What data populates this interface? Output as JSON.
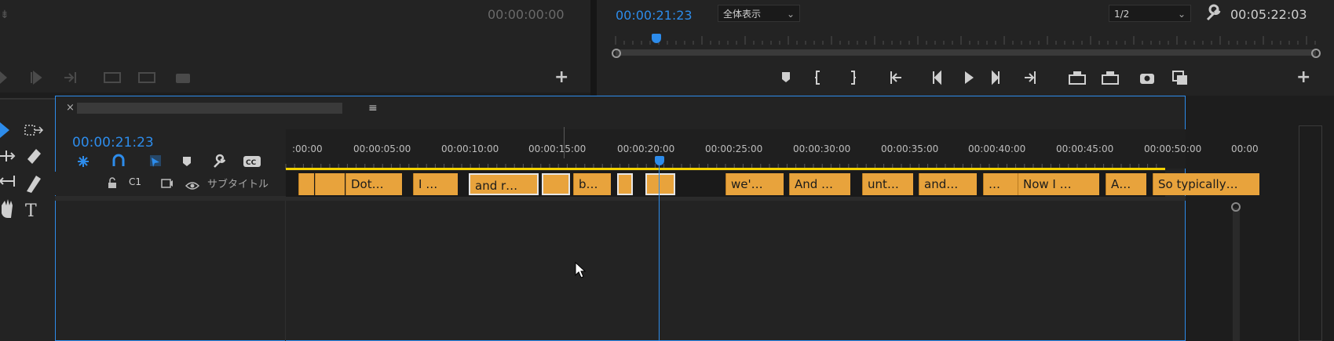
{
  "source_monitor": {
    "timecode": "00:00:00:00"
  },
  "program_monitor": {
    "current_timecode": "00:00:21:23",
    "zoom_select": "全体表示",
    "resolution_select": "1/2",
    "duration": "00:05:22:03"
  },
  "timeline": {
    "current_timecode": "00:00:21:23",
    "ruler_labels": [
      ":00:00",
      "00:00:05:00",
      "00:00:10:00",
      "00:00:15:00",
      "00:00:20:00",
      "00:00:25:00",
      "00:00:30:00",
      "00:00:35:00",
      "00:00:40:00",
      "00:00:45:00",
      "00:00:50:00",
      "00:00"
    ],
    "track": {
      "id": "C1",
      "name": "サブタイトル"
    },
    "clips": [
      "Dot…",
      "I …",
      "and r…",
      "b…",
      "we'…",
      "And …",
      "unt…",
      "and…",
      "…",
      "Now I …",
      "A…",
      "So typically…"
    ]
  },
  "icons": {
    "lock": "lock-icon",
    "eye": "eye-icon",
    "wrench": "wrench-icon"
  },
  "colors": {
    "accent": "#2d8ceb",
    "clip": "#e8a33c",
    "work_area": "#f2d100"
  }
}
